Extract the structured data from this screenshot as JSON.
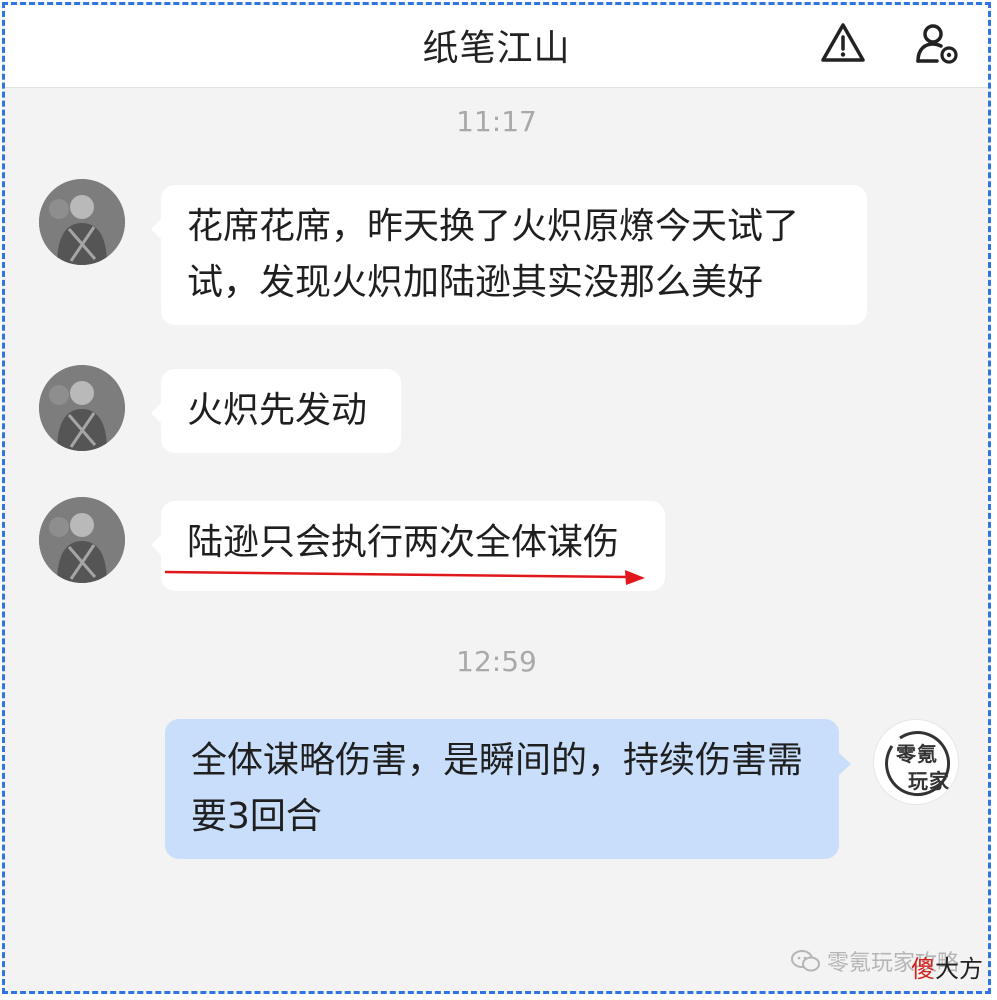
{
  "header": {
    "title": "纸笔江山"
  },
  "messages": {
    "time1": "11:17",
    "msg1": "花席花席，昨天换了火炽原燎今天试了试，发现火炽加陆逊其实没那么美好",
    "msg2": "火炽先发动",
    "msg3": "陆逊只会执行两次全体谋伤",
    "time2": "12:59",
    "msg4": "全体谋略伤害，是瞬间的，持续伤害需要3回合"
  },
  "my_avatar": {
    "line1": "零氪",
    "line2": "玩家"
  },
  "watermark": {
    "text": "零氪玩家攻略",
    "stamp_red": "傻",
    "stamp_black": "大方"
  },
  "colors": {
    "accent_border": "#2f74e0",
    "my_bubble": "#c8defb",
    "arrow": "#e0171b"
  }
}
